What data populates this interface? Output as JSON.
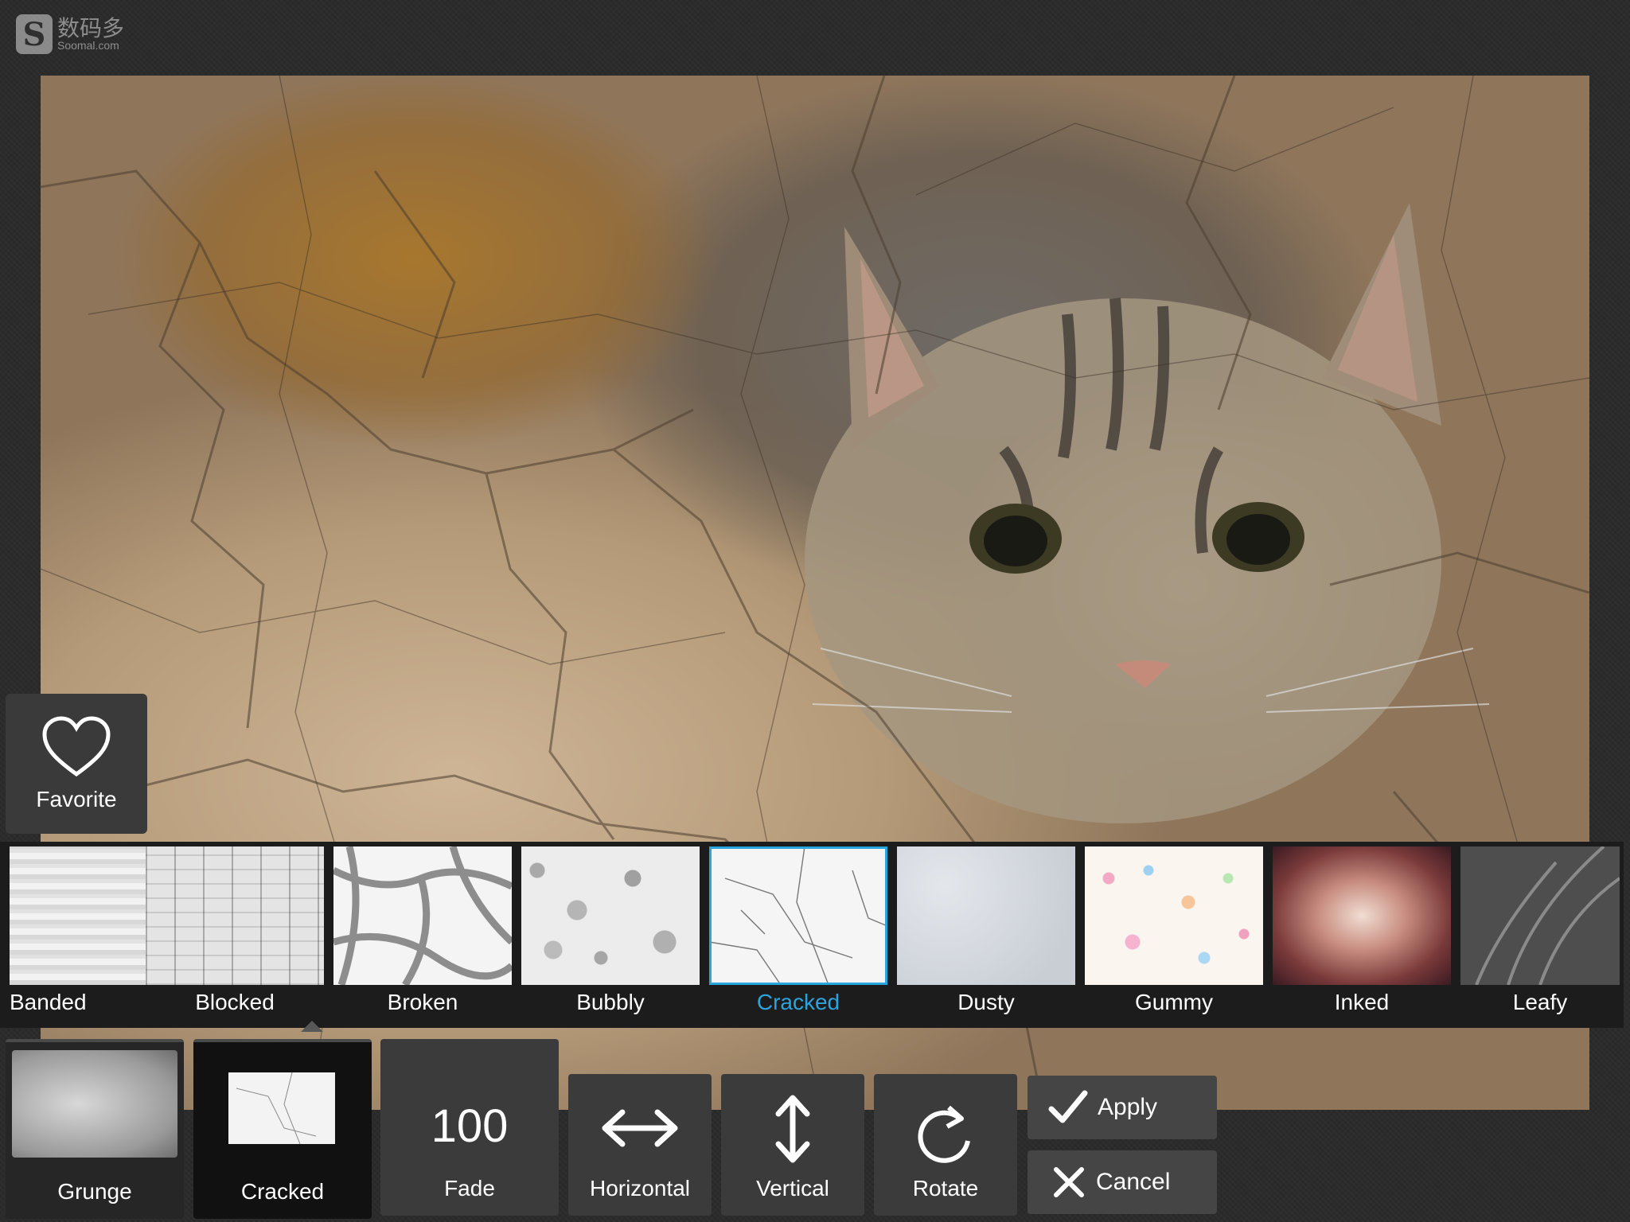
{
  "watermark": {
    "cn": "数码多",
    "en": "Soomal.com"
  },
  "favorite": {
    "label": "Favorite"
  },
  "textures": [
    {
      "name": "Banded",
      "selected": false
    },
    {
      "name": "Blocked",
      "selected": false
    },
    {
      "name": "Broken",
      "selected": false
    },
    {
      "name": "Bubbly",
      "selected": false
    },
    {
      "name": "Cracked",
      "selected": true
    },
    {
      "name": "Dusty",
      "selected": false
    },
    {
      "name": "Gummy",
      "selected": false
    },
    {
      "name": "Inked",
      "selected": false
    },
    {
      "name": "Leafy",
      "selected": false
    }
  ],
  "toolbar": {
    "category_prev": "Grunge",
    "category_current": "Cracked",
    "fade_value": "100",
    "fade_label": "Fade",
    "horizontal_label": "Horizontal",
    "vertical_label": "Vertical",
    "rotate_label": "Rotate",
    "apply_label": "Apply",
    "cancel_label": "Cancel"
  },
  "colors": {
    "accent": "#28a6de",
    "panel": "#3b3b3b",
    "strip": "#1c1c1c"
  },
  "icons": [
    "heart-icon",
    "swap-horizontal-icon",
    "swap-vertical-icon",
    "rotate-icon",
    "check-icon",
    "close-icon"
  ]
}
